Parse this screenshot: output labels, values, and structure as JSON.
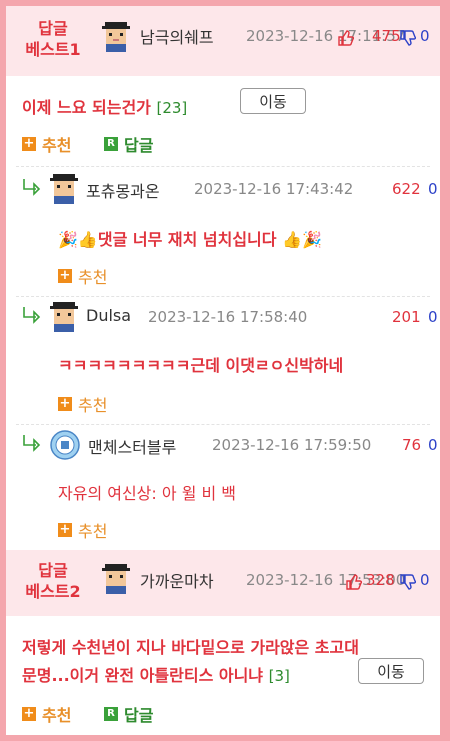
{
  "best1": {
    "label_line1": "답글",
    "label_line2": "베스트1",
    "nickname": "남극의쉐프",
    "date": "2023-12-16 17:11:57",
    "up_count": "475",
    "down_count": "0",
    "title": "이제 느요 되는건가",
    "reply_count": "[23]",
    "move_label": "이동",
    "recommend_label": "추천",
    "reply_label": "답글"
  },
  "replies": [
    {
      "nickname": "포츄몽과온",
      "date": "2023-12-16 17:43:42",
      "up_count": "622",
      "down_count": "0",
      "text": "🎉👍댓글 너무 재치 넘치십니다 👍🎉",
      "recommend_label": "추천"
    },
    {
      "nickname": "Dulsa",
      "date": "2023-12-16 17:58:40",
      "up_count": "201",
      "down_count": "0",
      "text": "ㅋㅋㅋㅋㅋㅋㅋㅋㅋ근데 이댓ㄹㅇ신박하네",
      "recommend_label": "추천"
    },
    {
      "nickname": "맨체스터블루",
      "date": "2023-12-16 17:59:50",
      "up_count": "76",
      "down_count": "0",
      "text": "자유의 여신상: 아 윌 비 백",
      "recommend_label": "추천"
    }
  ],
  "best2": {
    "label_line1": "답글",
    "label_line2": "베스트2",
    "nickname": "가까운마차",
    "date": "2023-12-16 17:53:00",
    "up_count": "328",
    "down_count": "0",
    "title_line1": "저렇게 수천년이 지나 바다밑으로 가라앉은 초고대",
    "title_line2": "문명...이거 완전 아틀란티스 아니냐",
    "reply_count": "[3]",
    "move_label": "이동",
    "recommend_label": "추천",
    "reply_label": "답글"
  },
  "colors": {
    "accent_red": "#e0333d",
    "frame_pink": "#f4a6ad",
    "best_bg": "#fde7ea",
    "recommend_orange": "#f08c1a",
    "reply_green": "#3aa13a",
    "down_blue": "#2d42c8"
  },
  "icons": [
    "pixel-avatar-icon",
    "thumbs-up-icon",
    "thumbs-down-icon",
    "reply-arrow-icon",
    "plus-box-icon",
    "r-box-icon",
    "club-badge-icon"
  ]
}
